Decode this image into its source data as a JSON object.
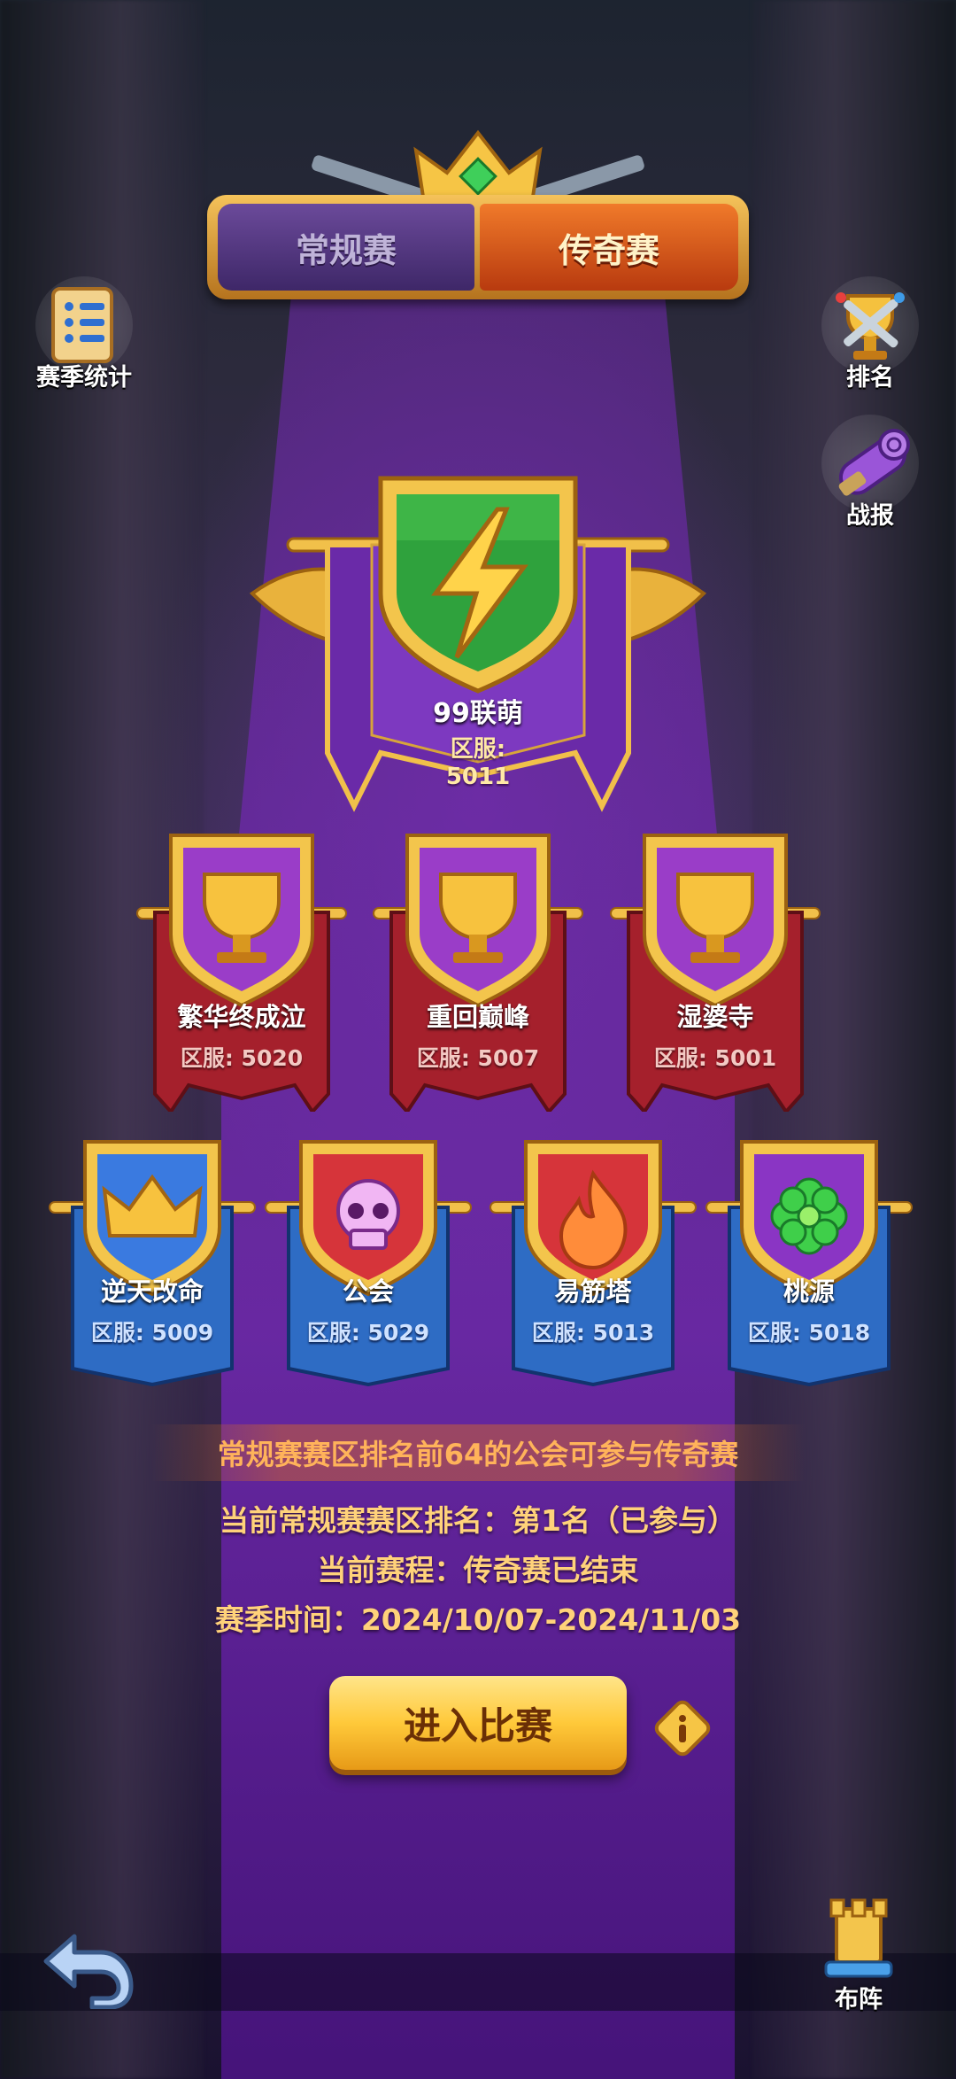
{
  "tabs": {
    "regular": "常规赛",
    "legend": "传奇赛",
    "active": "legend"
  },
  "side_buttons": {
    "season_stats": "赛季统计",
    "ranking": "排名",
    "battle_report": "战报",
    "formation": "布阵"
  },
  "champion": {
    "name": "99联萌",
    "server": "区服: 5011",
    "icon": "lightning-icon"
  },
  "semifinal": [
    {
      "name": "繁华终成泣",
      "server": "区服: 5020",
      "icon": "trophy-icon"
    },
    {
      "name": "重回巅峰",
      "server": "区服: 5007",
      "icon": "trophy-icon"
    },
    {
      "name": "湿婆寺",
      "server": "区服: 5001",
      "icon": "trophy-icon"
    }
  ],
  "quarterfinal": [
    {
      "name": "逆天改命",
      "server": "区服: 5009",
      "icon": "crown-icon"
    },
    {
      "name": "公会",
      "server": "区服: 5029",
      "icon": "skull-icon"
    },
    {
      "name": "易筋塔",
      "server": "区服: 5013",
      "icon": "flame-icon"
    },
    {
      "name": "桃源",
      "server": "区服: 5018",
      "icon": "clover-icon"
    }
  ],
  "info": {
    "rule": "常规赛赛区排名前64的公会可参与传奇赛",
    "rank": "当前常规赛赛区排名：第1名（已参与）",
    "schedule": "当前赛程：传奇赛已结束",
    "season_time": "赛季时间：2024/10/07-2024/11/03"
  },
  "enter_button": "进入比赛",
  "colors": {
    "gold": "#f5c25a",
    "purple": "#6a2aa8",
    "orange_tab": "#e0621f",
    "red_banner": "#a5202c",
    "blue_banner": "#2e6cc4"
  }
}
